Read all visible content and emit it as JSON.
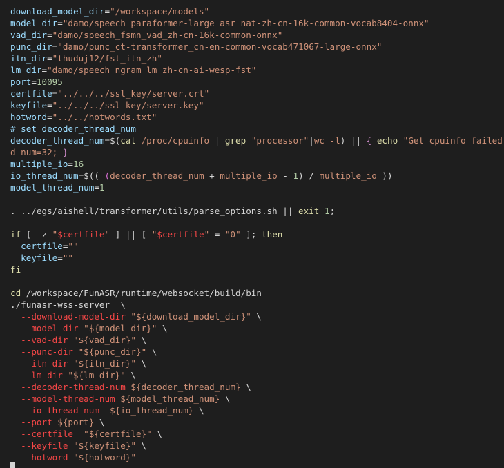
{
  "colors": {
    "background": "#1e1e1e",
    "var": "#9cdcfe",
    "str": "#ce9178",
    "num": "#b5cea8",
    "kw": "#dcdcaa",
    "op": "#d4d4d4",
    "cmt": "#6a9955",
    "flag": "#f44747",
    "brace": "#c586c0",
    "paren": "#da70d6",
    "bash": "#d4d4d4"
  },
  "lines": [
    [
      [
        "download_model_dir",
        "var"
      ],
      [
        "=",
        "op"
      ],
      [
        "\"/workspace/models\"",
        "str"
      ]
    ],
    [
      [
        "model_dir",
        "var"
      ],
      [
        "=",
        "op"
      ],
      [
        "\"damo/speech_paraformer-large_asr_nat-zh-cn-16k-common-vocab8404-onnx\"",
        "str"
      ]
    ],
    [
      [
        "vad_dir",
        "var"
      ],
      [
        "=",
        "op"
      ],
      [
        "\"damo/speech_fsmn_vad_zh-cn-16k-common-onnx\"",
        "str"
      ]
    ],
    [
      [
        "punc_dir",
        "var"
      ],
      [
        "=",
        "op"
      ],
      [
        "\"damo/punc_ct-transformer_cn-en-common-vocab471067-large-onnx\"",
        "str"
      ]
    ],
    [
      [
        "itn_dir",
        "var"
      ],
      [
        "=",
        "op"
      ],
      [
        "\"thuduj12/fst_itn_zh\"",
        "str"
      ]
    ],
    [
      [
        "lm_dir",
        "var"
      ],
      [
        "=",
        "op"
      ],
      [
        "\"damo/speech_ngram_lm_zh-cn-ai-wesp-fst\"",
        "str"
      ]
    ],
    [
      [
        "port",
        "var"
      ],
      [
        "=",
        "op"
      ],
      [
        "10095",
        "num"
      ]
    ],
    [
      [
        "certfile",
        "var"
      ],
      [
        "=",
        "op"
      ],
      [
        "\"../../../ssl_key/server.crt\"",
        "str"
      ]
    ],
    [
      [
        "keyfile",
        "var"
      ],
      [
        "=",
        "op"
      ],
      [
        "\"../../../ssl_key/server.key\"",
        "str"
      ]
    ],
    [
      [
        "hotword",
        "var"
      ],
      [
        "=",
        "op"
      ],
      [
        "\"../../hotwords.txt\"",
        "str"
      ]
    ],
    [
      [
        "# set decoder_thread_num",
        "var"
      ]
    ],
    [
      [
        "decoder_thread_num",
        "var"
      ],
      [
        "=$(",
        "op"
      ],
      [
        "cat",
        "kw"
      ],
      [
        " /proc/cpuinfo ",
        "str"
      ],
      [
        "|",
        "op"
      ],
      [
        " grep ",
        "kw"
      ],
      [
        "\"processor\"",
        "str"
      ],
      [
        "|",
        "op"
      ],
      [
        "wc -l",
        "str"
      ],
      [
        ")",
        "op"
      ],
      [
        " || ",
        "op"
      ],
      [
        "{",
        "brace"
      ],
      [
        " echo ",
        "kw"
      ],
      [
        "\"Get cpuinfo failed. Set de",
        "str"
      ]
    ],
    [
      [
        "d_num=32; ",
        "str"
      ],
      [
        "}",
        "brace"
      ]
    ],
    [
      [
        "multiple_io",
        "var"
      ],
      [
        "=",
        "op"
      ],
      [
        "16",
        "num"
      ]
    ],
    [
      [
        "io_thread_num",
        "var"
      ],
      [
        "=$((",
        "op"
      ],
      [
        " (",
        "paren"
      ],
      [
        "decoder_thread_num",
        "str"
      ],
      [
        " + ",
        "op"
      ],
      [
        "multiple_io",
        "str"
      ],
      [
        " - ",
        "op"
      ],
      [
        "1",
        "num"
      ],
      [
        ") / ",
        "op"
      ],
      [
        "multiple_io",
        "str"
      ],
      [
        " ))",
        "op"
      ]
    ],
    [
      [
        "model_thread_num",
        "var"
      ],
      [
        "=",
        "op"
      ],
      [
        "1",
        "num"
      ]
    ],
    [],
    [
      [
        ". ",
        "op"
      ],
      [
        "../egs/aishell/transformer/utils/parse_options.sh",
        "bash"
      ],
      [
        " || ",
        "op"
      ],
      [
        "exit",
        "kw"
      ],
      [
        " 1",
        "num"
      ],
      [
        ";",
        "op"
      ]
    ],
    [],
    [
      [
        "if",
        "kw"
      ],
      [
        " [ -z ",
        "op"
      ],
      [
        "\"",
        "str"
      ],
      [
        "$certfile",
        "flag"
      ],
      [
        "\"",
        "str"
      ],
      [
        " ] || [ ",
        "op"
      ],
      [
        "\"",
        "str"
      ],
      [
        "$certfile",
        "flag"
      ],
      [
        "\"",
        "str"
      ],
      [
        " = ",
        "op"
      ],
      [
        "\"0\"",
        "str"
      ],
      [
        " ]; ",
        "op"
      ],
      [
        "then",
        "kw"
      ]
    ],
    [
      [
        "  certfile",
        "var"
      ],
      [
        "=",
        "op"
      ],
      [
        "\"\"",
        "str"
      ]
    ],
    [
      [
        "  keyfile",
        "var"
      ],
      [
        "=",
        "op"
      ],
      [
        "\"\"",
        "str"
      ]
    ],
    [
      [
        "fi",
        "kw"
      ]
    ],
    [],
    [
      [
        "cd",
        "kw"
      ],
      [
        " /workspace/FunASR/runtime/websocket/build/bin",
        "bash"
      ]
    ],
    [
      [
        "./funasr-wss-server  \\",
        "bash"
      ]
    ],
    [
      [
        "  --download-model-dir ",
        "flag"
      ],
      [
        "\"${download_model_dir}\"",
        "str"
      ],
      [
        " \\",
        "op"
      ]
    ],
    [
      [
        "  --model-dir ",
        "flag"
      ],
      [
        "\"${model_dir}\"",
        "str"
      ],
      [
        " \\",
        "op"
      ]
    ],
    [
      [
        "  --vad-dir ",
        "flag"
      ],
      [
        "\"${vad_dir}\"",
        "str"
      ],
      [
        " \\",
        "op"
      ]
    ],
    [
      [
        "  --punc-dir ",
        "flag"
      ],
      [
        "\"${punc_dir}\"",
        "str"
      ],
      [
        " \\",
        "op"
      ]
    ],
    [
      [
        "  --itn-dir ",
        "flag"
      ],
      [
        "\"${itn_dir}\"",
        "str"
      ],
      [
        " \\",
        "op"
      ]
    ],
    [
      [
        "  --lm-dir ",
        "flag"
      ],
      [
        "\"${lm_dir}\"",
        "str"
      ],
      [
        " \\",
        "op"
      ]
    ],
    [
      [
        "  --decoder-thread-num ",
        "flag"
      ],
      [
        "${decoder_thread_num}",
        "str"
      ],
      [
        " \\",
        "op"
      ]
    ],
    [
      [
        "  --model-thread-num ",
        "flag"
      ],
      [
        "${model_thread_num}",
        "str"
      ],
      [
        " \\",
        "op"
      ]
    ],
    [
      [
        "  --io-thread-num  ",
        "flag"
      ],
      [
        "${io_thread_num}",
        "str"
      ],
      [
        " \\",
        "op"
      ]
    ],
    [
      [
        "  --port ",
        "flag"
      ],
      [
        "${port}",
        "str"
      ],
      [
        " \\",
        "op"
      ]
    ],
    [
      [
        "  --certfile  ",
        "flag"
      ],
      [
        "\"${certfile}\"",
        "str"
      ],
      [
        " \\",
        "op"
      ]
    ],
    [
      [
        "  --keyfile ",
        "flag"
      ],
      [
        "\"${keyfile}\"",
        "str"
      ],
      [
        " \\",
        "op"
      ]
    ],
    [
      [
        "  --hotword ",
        "flag"
      ],
      [
        "\"${hotword}\"",
        "str"
      ]
    ]
  ]
}
